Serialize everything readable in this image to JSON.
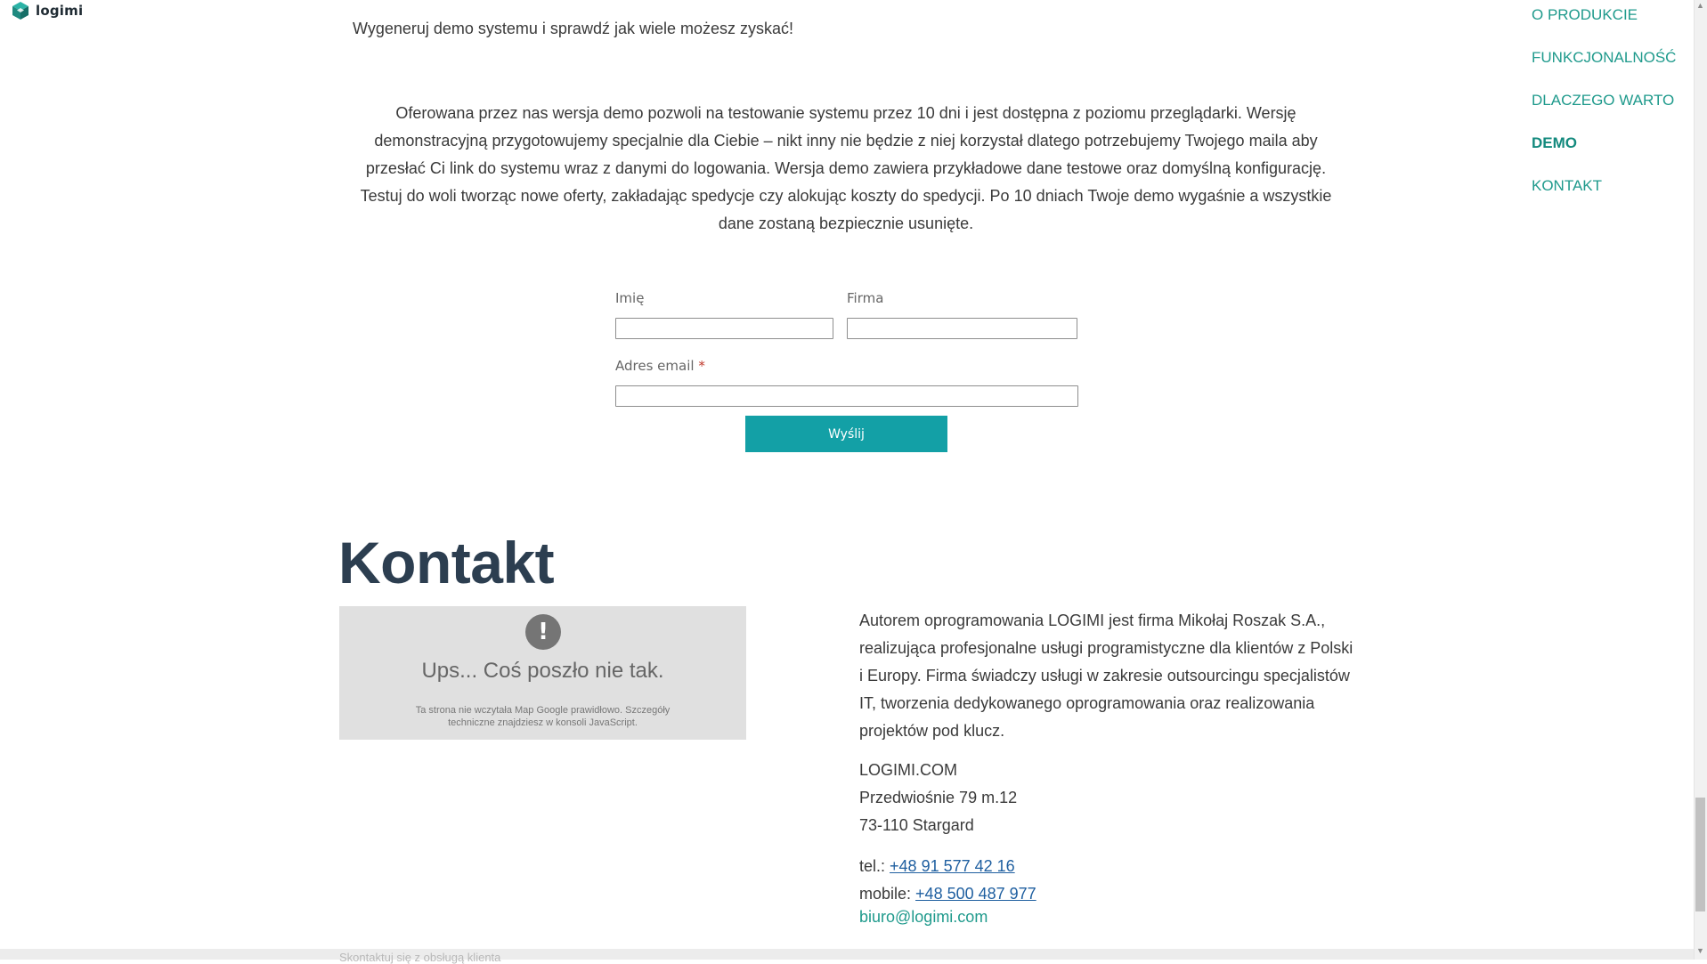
{
  "logo": {
    "text": "logimi",
    "icon": "logimi-cube-icon",
    "color": "#1f9a8c"
  },
  "nav": {
    "items": [
      {
        "label": "O PRODUKCIE",
        "active": false
      },
      {
        "label": "FUNKCJONALNOŚĆ",
        "active": false
      },
      {
        "label": "DLACZEGO WARTO",
        "active": false
      },
      {
        "label": "DEMO",
        "active": true
      },
      {
        "label": "KONTAKT",
        "active": false
      }
    ],
    "color": "#1f9a8c"
  },
  "demo": {
    "intro": "Wygeneruj demo systemu i sprawdź jak wiele możesz zyskać!",
    "description": "Oferowana przez nas wersja demo pozwoli na testowanie systemu przez 10 dni i jest dostępna z poziomu przeglądarki. Wersję demonstracyjną przygotowujemy specjalnie dla Ciebie – nikt inny nie będzie z niej korzystał dlatego potrzebujemy Twojego maila aby przesłać Ci link do systemu wraz z danymi do logowania. Wersja demo zawiera przykładowe dane testowe oraz domyślną konfigurację. Testuj do woli tworząc nowe oferty, zakładając spedycje czy alokując koszty do spedycji. Po 10 dniach Twoje demo wygaśnie a wszystkie dane zostaną bezpiecznie usunięte."
  },
  "form": {
    "name_label": "Imię",
    "name_value": "",
    "company_label": "Firma",
    "company_value": "",
    "email_label": "Adres email",
    "email_required_mark": "*",
    "email_value": "",
    "submit_label": "Wyślij",
    "submit_color": "#13a0a6"
  },
  "contact": {
    "title": "Kontakt",
    "map_error": {
      "icon": "exclamation-icon",
      "title": "Ups... Coś poszło nie tak.",
      "subtitle": "Ta strona nie wczytała Map Google prawidłowo. Szczegóły techniczne znajdziesz w konsoli JavaScript."
    },
    "about": "Autorem oprogramowania LOGIMI jest firma Mikołaj Roszak S.A., realizująca profesjonalne usługi programistyczne dla klientów z Polski i Europy. Firma świadczy usługi w zakresie outsourcingu specjalistów IT, tworzenia dedykowanego oprogramowania oraz realizowania projektów pod klucz.",
    "address": {
      "line1": "LOGIMI.COM",
      "line2": "Przedwiośnie 79 m.12",
      "line3": "73-110 Stargard"
    },
    "tel_label": "tel.:",
    "tel": "+48 91 577 42 16",
    "mobile_label": "mobile:",
    "mobile": "+48 500 487 977",
    "email": "biuro@logimi.com"
  },
  "footer": {
    "cut_text": "Skontaktuj się z obsługą klienta"
  }
}
